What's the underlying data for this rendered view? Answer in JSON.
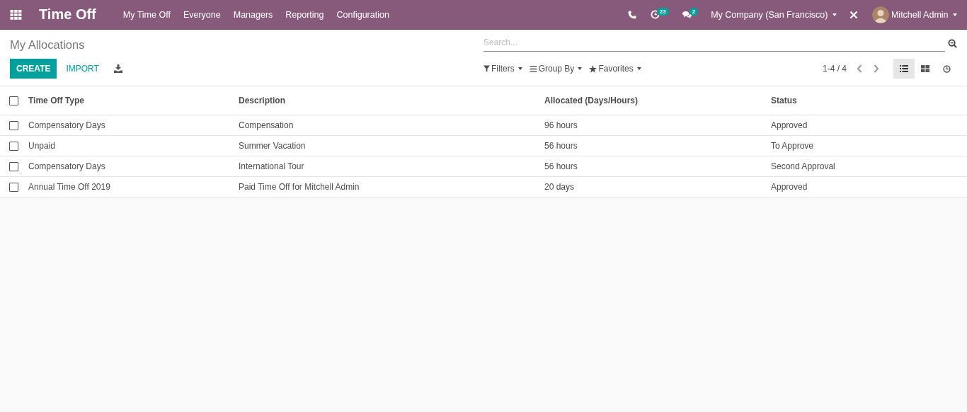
{
  "navbar": {
    "app_title": "Time Off",
    "menu": [
      "My Time Off",
      "Everyone",
      "Managers",
      "Reporting",
      "Configuration"
    ],
    "activity_count": "23",
    "message_count": "2",
    "company": "My Company (San Francisco)",
    "user": "Mitchell Admin"
  },
  "control_panel": {
    "title": "My Allocations",
    "search": {
      "placeholder": "Search..."
    },
    "create": "CREATE",
    "import": "IMPORT",
    "filters": "Filters",
    "group_by": "Group By",
    "favorites": "Favorites",
    "pager": "1-4 / 4",
    "views": [
      {
        "kind": "list",
        "selected": true
      },
      {
        "kind": "kanban",
        "selected": false
      },
      {
        "kind": "activity",
        "selected": false
      }
    ]
  },
  "table": {
    "select_all": {
      "checked": false
    },
    "columns": [
      "Time Off Type",
      "Description",
      "Allocated (Days/Hours)",
      "Status"
    ],
    "rows": [
      {
        "checked": false,
        "cells": [
          "Compensatory Days",
          "Compensation",
          "96 hours",
          "Approved"
        ]
      },
      {
        "checked": false,
        "cells": [
          "Unpaid",
          "Summer Vacation",
          "56 hours",
          "To Approve"
        ]
      },
      {
        "checked": false,
        "cells": [
          "Compensatory Days",
          "International Tour",
          "56 hours",
          "Second Approval"
        ]
      },
      {
        "checked": false,
        "cells": [
          "Annual Time Off 2019",
          "Paid Time Off for Mitchell Admin",
          "20 days",
          "Approved"
        ]
      }
    ]
  }
}
